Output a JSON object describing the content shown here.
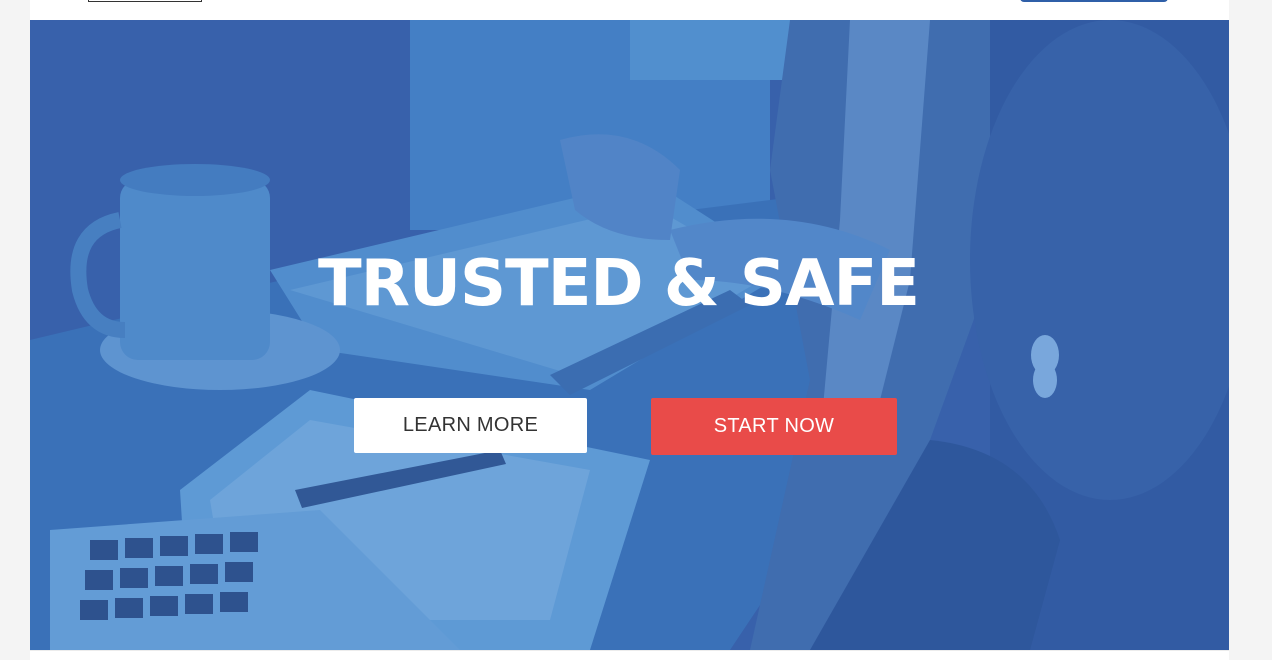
{
  "header": {
    "logo_icon": "logo",
    "cta_icon": "header-button"
  },
  "hero": {
    "title": "TRUSTED & SAFE",
    "learn_more_label": "LEARN MORE",
    "start_now_label": "START NOW",
    "overlay_color": "#3a5fa9",
    "accent_color": "#e94b49"
  }
}
